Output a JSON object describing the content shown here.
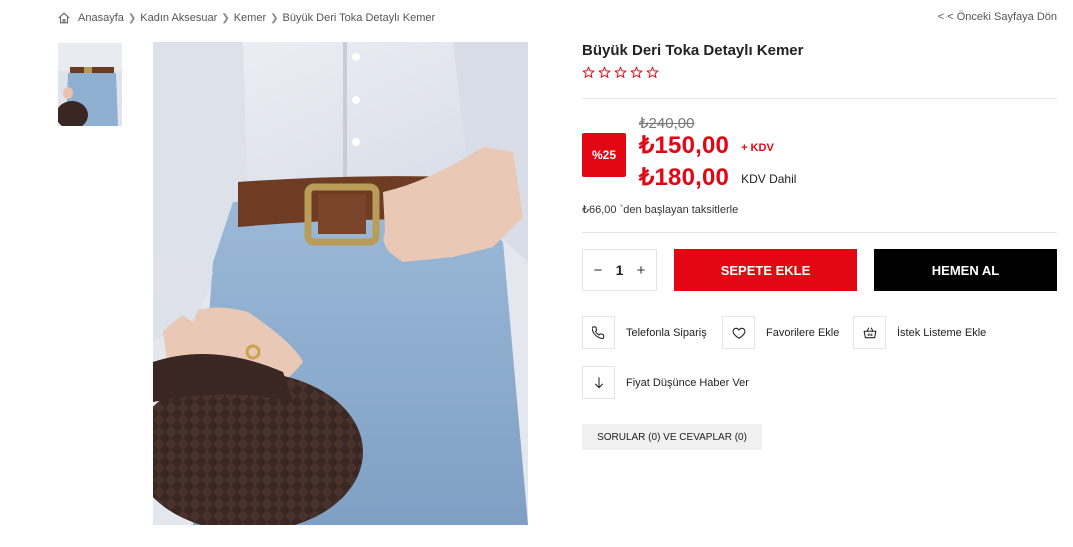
{
  "breadcrumb": {
    "items": [
      "Anasayfa",
      "Kadın Aksesuar",
      "Kemer",
      "Büyük Deri Toka Detaylı Kemer"
    ],
    "back_label": "< < Önceki Sayfaya Dön"
  },
  "product": {
    "title": "Büyük Deri Toka Detaylı Kemer",
    "rating": {
      "filled": 0,
      "total": 5
    },
    "old_price": "₺240,00",
    "discount_badge": "%25",
    "price_ex_vat": "₺150,00",
    "price_ex_vat_note": "+ KDV",
    "price_inc_vat": "₺180,00",
    "price_inc_vat_note": "KDV Dahil",
    "installment_text": "₺66,00 `den başlayan taksitlerle"
  },
  "purchase": {
    "quantity": "1",
    "minus": "−",
    "plus": "+",
    "add_to_cart": "SEPETE EKLE",
    "buy_now": "HEMEN AL"
  },
  "actions": {
    "phone_order": "Telefonla Sipariş",
    "add_favorites": "Favorilere Ekle",
    "add_wishlist": "İstek Listeme Ekle",
    "price_alert": "Fiyat Düşünce Haber Ver"
  },
  "qa_label": "SORULAR (0) VE CEVAPLAR (0)",
  "colors": {
    "accent_red": "#e30613",
    "buy_button": "#000000",
    "star_outline": "#e30613"
  },
  "icons": [
    "home-icon",
    "chevron-right-icon",
    "star-outline-icon",
    "phone-icon",
    "heart-icon",
    "basket-icon",
    "arrow-down-icon"
  ]
}
